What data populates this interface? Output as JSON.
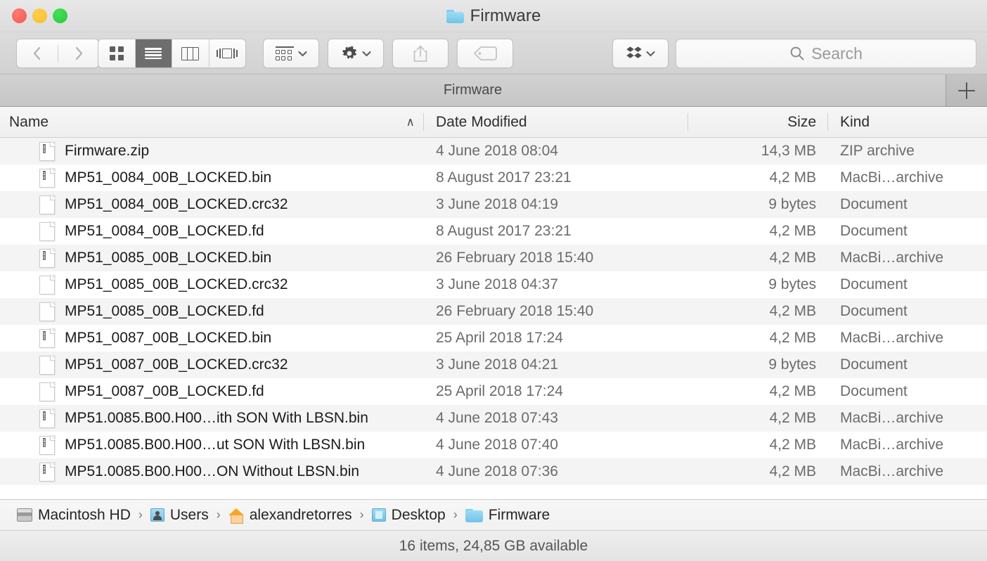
{
  "window": {
    "title": "Firmware",
    "title_icon": "folder-icon",
    "traffic_lights": [
      {
        "name": "close-button",
        "color": "#f7564e"
      },
      {
        "name": "minimize-button",
        "color": "#f9bc2b"
      },
      {
        "name": "zoom-button",
        "color": "#23c93b"
      }
    ]
  },
  "toolbar": {
    "back_icon": "chevron-left-icon",
    "forward_icon": "chevron-right-icon",
    "view_modes": [
      {
        "name": "icon-view",
        "icon": "grid-icon",
        "active": false
      },
      {
        "name": "list-view",
        "icon": "list-icon",
        "active": true
      },
      {
        "name": "column-view",
        "icon": "columns-icon",
        "active": false
      },
      {
        "name": "gallery-view",
        "icon": "coverflow-icon",
        "active": false
      }
    ],
    "arrange_icon": "arrange-icon",
    "action_icon": "gear-icon",
    "share_icon": "share-icon",
    "tag_icon": "tag-icon",
    "dropbox_icon": "dropbox-icon",
    "dropdown_caret_icon": "chevron-down-icon"
  },
  "search": {
    "placeholder": "Search",
    "value": "",
    "icon": "search-icon"
  },
  "tabbar": {
    "tabs": [
      {
        "label": "Firmware",
        "active": true
      }
    ],
    "new_tab_icon": "plus-icon"
  },
  "columns": {
    "name": "Name",
    "date_modified": "Date Modified",
    "size": "Size",
    "kind": "Kind",
    "sort_column": "Name",
    "sort_arrow": "∧"
  },
  "files": [
    {
      "name": "Firmware.zip",
      "icon": "binary-document-icon",
      "date": "4 June 2018 08:04",
      "size": "14,3 MB",
      "kind": "ZIP archive"
    },
    {
      "name": "MP51_0084_00B_LOCKED.bin",
      "icon": "binary-document-icon",
      "date": "8 August 2017 23:21",
      "size": "4,2 MB",
      "kind": "MacBi…archive"
    },
    {
      "name": "MP51_0084_00B_LOCKED.crc32",
      "icon": "plain-document-icon",
      "date": "3 June 2018 04:19",
      "size": "9 bytes",
      "kind": "Document"
    },
    {
      "name": "MP51_0084_00B_LOCKED.fd",
      "icon": "plain-document-icon",
      "date": "8 August 2017 23:21",
      "size": "4,2 MB",
      "kind": "Document"
    },
    {
      "name": "MP51_0085_00B_LOCKED.bin",
      "icon": "binary-document-icon",
      "date": "26 February 2018 15:40",
      "size": "4,2 MB",
      "kind": "MacBi…archive"
    },
    {
      "name": "MP51_0085_00B_LOCKED.crc32",
      "icon": "plain-document-icon",
      "date": "3 June 2018 04:37",
      "size": "9 bytes",
      "kind": "Document"
    },
    {
      "name": "MP51_0085_00B_LOCKED.fd",
      "icon": "plain-document-icon",
      "date": "26 February 2018 15:40",
      "size": "4,2 MB",
      "kind": "Document"
    },
    {
      "name": "MP51_0087_00B_LOCKED.bin",
      "icon": "binary-document-icon",
      "date": "25 April 2018 17:24",
      "size": "4,2 MB",
      "kind": "MacBi…archive"
    },
    {
      "name": "MP51_0087_00B_LOCKED.crc32",
      "icon": "plain-document-icon",
      "date": "3 June 2018 04:21",
      "size": "9 bytes",
      "kind": "Document"
    },
    {
      "name": "MP51_0087_00B_LOCKED.fd",
      "icon": "plain-document-icon",
      "date": "25 April 2018 17:24",
      "size": "4,2 MB",
      "kind": "Document"
    },
    {
      "name": "MP51.0085.B00.H00…ith SON With LBSN.bin",
      "icon": "binary-document-icon",
      "date": "4 June 2018 07:43",
      "size": "4,2 MB",
      "kind": "MacBi…archive"
    },
    {
      "name": "MP51.0085.B00.H00…ut SON With LBSN.bin",
      "icon": "binary-document-icon",
      "date": "4 June 2018 07:40",
      "size": "4,2 MB",
      "kind": "MacBi…archive"
    },
    {
      "name": "MP51.0085.B00.H00…ON Without LBSN.bin",
      "icon": "binary-document-icon",
      "date": "4 June 2018 07:36",
      "size": "4,2 MB",
      "kind": "MacBi…archive"
    }
  ],
  "pathbar": {
    "separator": "›",
    "crumbs": [
      {
        "label": "Macintosh HD",
        "icon": "harddisk-icon"
      },
      {
        "label": "Users",
        "icon": "users-folder-icon"
      },
      {
        "label": "alexandretorres",
        "icon": "home-folder-icon"
      },
      {
        "label": "Desktop",
        "icon": "desktop-folder-icon"
      },
      {
        "label": "Firmware",
        "icon": "folder-icon"
      }
    ]
  },
  "statusbar": {
    "text": "16 items, 24,85 GB available"
  }
}
